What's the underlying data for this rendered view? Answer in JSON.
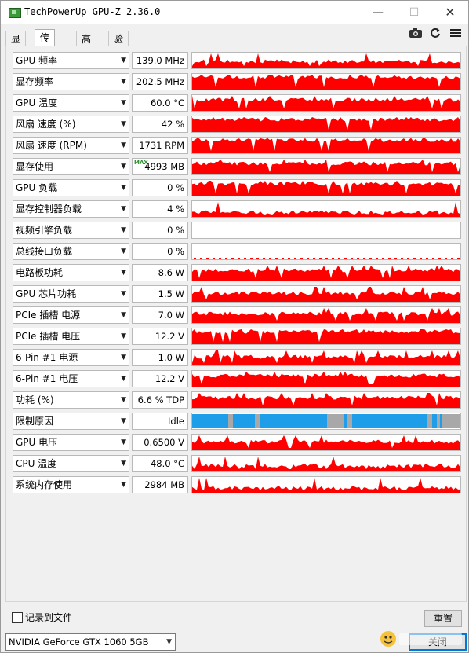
{
  "window": {
    "title": "TechPowerUp GPU-Z 2.36.0",
    "min_glyph": "—",
    "max_glyph": "☐",
    "close_glyph": "✕"
  },
  "tabs": [
    {
      "label": "显卡",
      "active": false
    },
    {
      "label": "传感器",
      "active": true
    },
    {
      "label": "高级",
      "active": false
    },
    {
      "label": "验证",
      "active": false
    }
  ],
  "toolbar": {
    "camera_icon": "camera-icon",
    "refresh_icon": "refresh-icon",
    "menu_icon": "menu-icon"
  },
  "colors": {
    "graph_red": "#ff0000",
    "graph_blue": "#1e9ee8",
    "graph_gray": "#a8a8a8",
    "max_badge": "#2f8f2f",
    "close_border": "#0078d7"
  },
  "sensors": [
    {
      "name": "GPU 频率",
      "value": "139.0 MHz"
    },
    {
      "name": "显存频率",
      "value": "202.5 MHz"
    },
    {
      "name": "GPU 温度",
      "value": "60.0 °C"
    },
    {
      "name": "风扇 速度 (%)",
      "value": "42 %"
    },
    {
      "name": "风扇 速度 (RPM)",
      "value": "1731 RPM"
    },
    {
      "name": "显存使用",
      "value": "4993 MB",
      "badge": "MAX"
    },
    {
      "name": "GPU 负载",
      "value": "0 %"
    },
    {
      "name": "显存控制器负载",
      "value": "4 %"
    },
    {
      "name": "视频引擎负载",
      "value": "0 %"
    },
    {
      "name": "总线接口负载",
      "value": "0 %"
    },
    {
      "name": "电路板功耗",
      "value": "8.6 W"
    },
    {
      "name": "GPU 芯片功耗",
      "value": "1.5 W"
    },
    {
      "name": "PCIe 插槽 电源",
      "value": "7.0 W"
    },
    {
      "name": "PCIe 插槽 电压",
      "value": "12.2 V"
    },
    {
      "name": "6-Pin #1 电源",
      "value": "1.0 W"
    },
    {
      "name": "6-Pin #1 电压",
      "value": "12.2 V"
    },
    {
      "name": "功耗 (%)",
      "value": "6.6 % TDP"
    },
    {
      "name": "限制原因",
      "value": "Idle"
    },
    {
      "name": "GPU 电压",
      "value": "0.6500 V"
    },
    {
      "name": "CPU 温度",
      "value": "48.0 °C"
    },
    {
      "name": "系统内存使用",
      "value": "2984 MB"
    }
  ],
  "bottom": {
    "log_label": "记录到文件",
    "reset_label": "重置",
    "close_label": "关闭",
    "gpu_selected": "NVIDIA GeForce GTX 1060 5GB"
  }
}
